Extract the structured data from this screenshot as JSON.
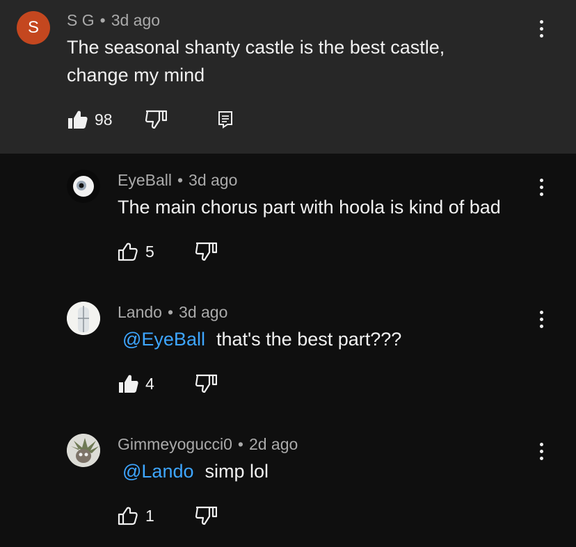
{
  "comment": {
    "avatar_letter": "S",
    "author": "S G",
    "separator": "•",
    "time": "3d ago",
    "text_line1": "The seasonal shanty castle is the best castle,",
    "text_line2": "change my mind",
    "likes": "98",
    "icons": {
      "like": "thumbs-up-filled-icon",
      "dislike": "thumbs-down-icon",
      "reply": "reply-icon",
      "more": "more-vertical-icon"
    }
  },
  "replies": [
    {
      "author": "EyeBall",
      "separator": "•",
      "time": "3d ago",
      "mention": "",
      "text": "The main chorus part with hoola is kind of bad",
      "likes": "5",
      "liked": false
    },
    {
      "author": "Lando",
      "separator": "•",
      "time": "3d ago",
      "mention": "@EyeBall",
      "text": "that's the best part???",
      "likes": "4",
      "liked": true
    },
    {
      "author": "Gimmeyogucci0",
      "separator": "•",
      "time": "2d ago",
      "mention": "@Lando",
      "text": "simp lol",
      "likes": "1",
      "liked": false
    }
  ],
  "colors": {
    "background": "#0f0f0f",
    "highlight": "#272727",
    "mention": "#3ea6ff",
    "avatar": "#c4471f",
    "meta": "#aaaaaa"
  }
}
